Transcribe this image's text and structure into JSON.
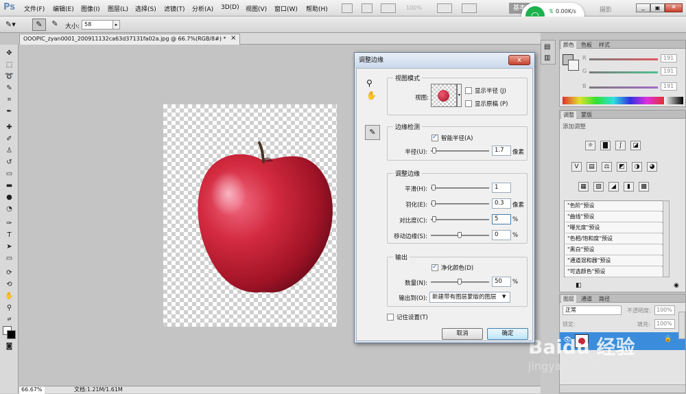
{
  "app": {
    "logo": "Ps",
    "menu": [
      "文件(F)",
      "编辑(E)",
      "图像(I)",
      "图层(L)",
      "选择(S)",
      "滤镜(T)",
      "分析(A)",
      "3D(D)",
      "视图(V)",
      "窗口(W)",
      "帮助(H)"
    ],
    "zoom": "100%",
    "workspace": "基本",
    "workspace_extra": "摄影"
  },
  "network_widget": {
    "speed": "0.00K/s",
    "count": "1"
  },
  "options_bar": {
    "size_label": "大小:",
    "size_value": "58"
  },
  "document": {
    "tab_title": "OOOPIC_zyan0001_200911132ca63d37131fa02a.jpg @ 66.7%(RGB/8#) *",
    "close": "×"
  },
  "status_bar": {
    "zoom": "66.67%",
    "doc_info": "文档:1.21M/1.61M"
  },
  "color_panel": {
    "tabs": [
      "颜色",
      "色板",
      "样式"
    ],
    "channels": [
      {
        "label": "R",
        "value": "191",
        "color": "#e0595f"
      },
      {
        "label": "G",
        "value": "191",
        "color": "#51bf8f"
      },
      {
        "label": "B",
        "value": "191",
        "color": "#a36bc7"
      }
    ]
  },
  "adjustments_panel": {
    "tabs": [
      "调整",
      "蒙版"
    ],
    "heading": "添加调整",
    "icons_row1": [
      "☼",
      "▇",
      "∫",
      "◪"
    ],
    "icons_row2": [
      "V",
      "▤",
      "⚖",
      "◩",
      "◑",
      "◕"
    ],
    "icons_row3": [
      "▦",
      "▨",
      "◢",
      "▮",
      "▩"
    ],
    "presets": [
      "\"色阶\"预设",
      "\"曲线\"预设",
      "\"曝光度\"预设",
      "\"色相/饱和度\"预设",
      "\"黑白\"预设",
      "\"通道混和器\"预设",
      "\"可选颜色\"预设"
    ]
  },
  "layers_panel": {
    "tabs": [
      "图层",
      "通道",
      "路径"
    ],
    "blend_mode": "正常",
    "opacity_label": "不透明度:",
    "opacity": "100%",
    "lock_label": "锁定:",
    "fill_label": "填充:",
    "fill": "100%"
  },
  "watermark": {
    "line1": "Baidu 经验",
    "line2": "jingyan.baidu.com"
  },
  "dialog": {
    "title": "调整边缘",
    "close": "x",
    "view_mode": {
      "group": "视图模式",
      "view_label": "视图:",
      "show_radius": "显示半径 (J)",
      "show_original": "显示原稿 (P)"
    },
    "edge_detection": {
      "group": "边缘检测",
      "smart_radius": "智能半径(A)",
      "radius_label": "半径(U):",
      "radius_value": "1.7",
      "radius_unit": "像素"
    },
    "adjust_edge": {
      "group": "调整边缘",
      "rows": [
        {
          "label": "平滑(H):",
          "value": "1",
          "unit": ""
        },
        {
          "label": "羽化(E):",
          "value": "0.3",
          "unit": "像素"
        },
        {
          "label": "对比度(C):",
          "value": "5",
          "unit": "%"
        },
        {
          "label": "移动边缘(S):",
          "value": "0",
          "unit": "%"
        }
      ]
    },
    "output": {
      "group": "输出",
      "decontaminate": "净化颜色(D)",
      "amount_label": "数量(N):",
      "amount_value": "50",
      "amount_unit": "%",
      "output_to_label": "输出到(O):",
      "output_to_value": "新建带有图层蒙版的图层"
    },
    "remember": "记住设置(T)",
    "cancel": "取消",
    "ok": "确定"
  }
}
